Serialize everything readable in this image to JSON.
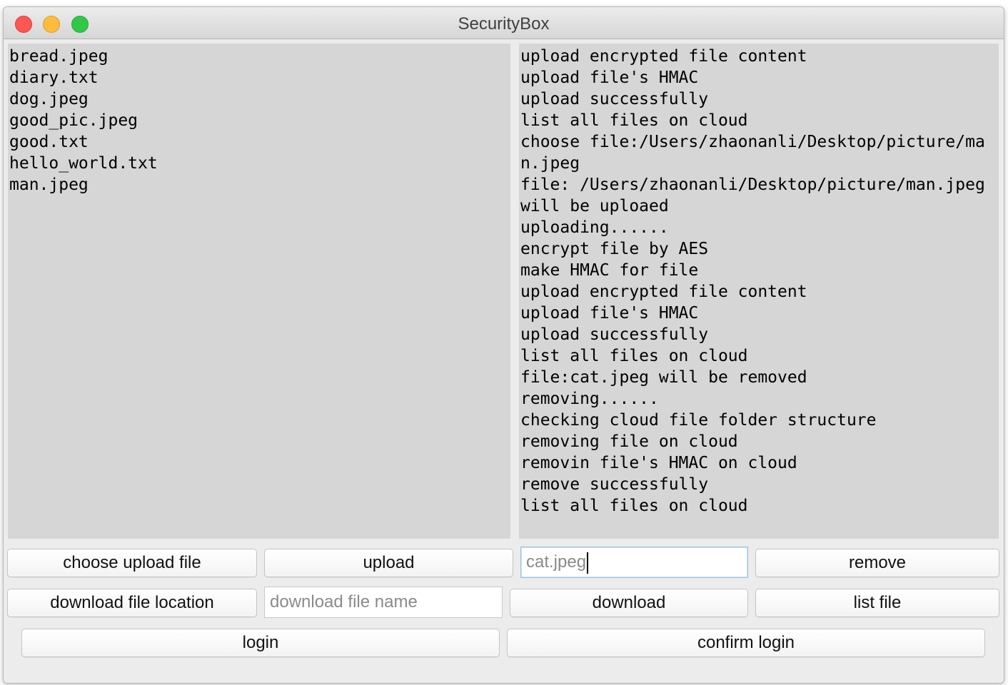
{
  "window": {
    "title": "SecurityBox"
  },
  "files_pane": {
    "items": [
      "bread.jpeg",
      "diary.txt",
      "dog.jpeg",
      "good_pic.jpeg",
      "good.txt",
      "hello_world.txt",
      "man.jpeg"
    ]
  },
  "log_pane": {
    "lines": [
      "upload encrypted file content",
      "upload file's HMAC",
      "upload successfully",
      "list all files on cloud",
      "choose file:/Users/zhaonanli/Desktop/picture/man.jpeg",
      "file: /Users/zhaonanli/Desktop/picture/man.jpeg will be uploaed",
      "uploading......",
      "encrypt file by AES",
      "make HMAC for file",
      "upload encrypted file content",
      "upload file's HMAC",
      "upload successfully",
      "list all files on cloud",
      "file:cat.jpeg will be removed",
      "removing......",
      "checking cloud file folder structure",
      "removing file on cloud",
      "removin file's HMAC on cloud",
      "remove successfully",
      "list all files on cloud"
    ]
  },
  "controls": {
    "choose_upload_file": "choose upload file",
    "upload": "upload",
    "remove_field_value": "cat.jpeg",
    "remove": "remove",
    "download_file_location": "download file location",
    "download_name_placeholder": "download file name",
    "download": "download",
    "list_file": "list file",
    "login": "login",
    "confirm_login": "confirm login"
  },
  "colors": {
    "close": "#fc5753",
    "minimize": "#fdbc40",
    "zoom": "#33c748",
    "pane_background": "#d6d6d6"
  }
}
